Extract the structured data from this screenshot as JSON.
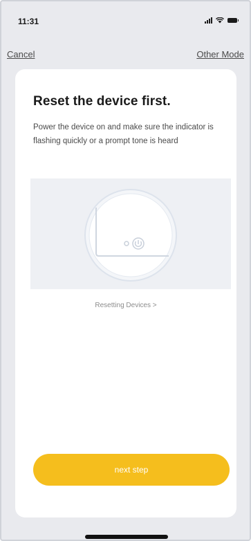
{
  "status_bar": {
    "time": "11:31",
    "icons": [
      "signal-icon",
      "wifi-icon",
      "battery-icon"
    ]
  },
  "nav": {
    "cancel_label": "Cancel",
    "other_mode_label": "Other Mode"
  },
  "content": {
    "title": "Reset the device first.",
    "description": "Power the device on and make sure the indicator is flashing quickly or a prompt tone is heard",
    "illustration_icon": "device-reset-illustration",
    "resetting_link": "Resetting Devices >",
    "next_button_label": "next step"
  },
  "colors": {
    "accent": "#f5be1d",
    "background": "#e9eaee",
    "card": "#ffffff",
    "illustration_bg": "#eef0f4"
  }
}
